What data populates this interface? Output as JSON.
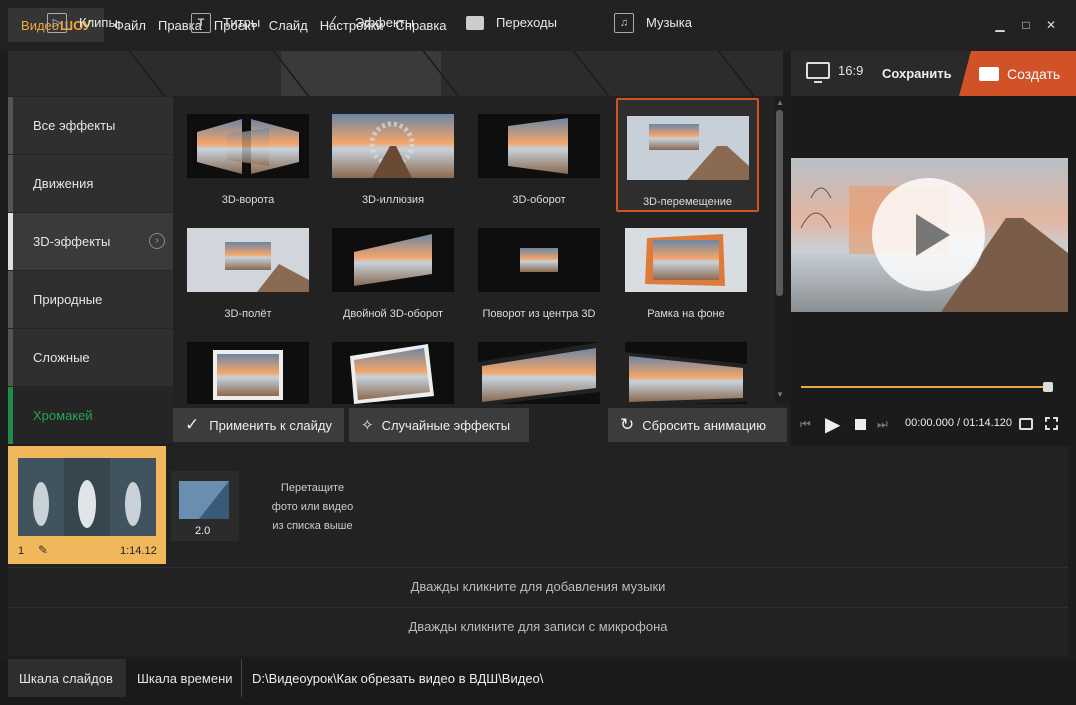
{
  "app": {
    "title_part1": "Видео",
    "title_part2": "ШОУ"
  },
  "menu": [
    "Файл",
    "Правка",
    "Проект",
    "Слайд",
    "Настройки",
    "Справка"
  ],
  "window_controls": {
    "minimize": "▁",
    "maximize": "□",
    "close": "✕"
  },
  "tabs": [
    {
      "label": "Клипы",
      "icon": "play-icon"
    },
    {
      "label": "Титры",
      "icon": "text-icon"
    },
    {
      "label": "Эффекты",
      "icon": "magic-wand-icon"
    },
    {
      "label": "Переходы",
      "icon": "clapper-icon"
    },
    {
      "label": "Музыка",
      "icon": "music-note-icon"
    }
  ],
  "header_right": {
    "ratio": "16:9",
    "save": "Сохранить",
    "create": "Создать"
  },
  "sidebar": [
    {
      "label": "Все эффекты"
    },
    {
      "label": "Движения"
    },
    {
      "label": "3D-эффекты",
      "active": true
    },
    {
      "label": "Природные"
    },
    {
      "label": "Сложные"
    },
    {
      "label": "Хромакей",
      "green": true
    }
  ],
  "effects": [
    {
      "label": "3D-ворота"
    },
    {
      "label": "3D-иллюзия"
    },
    {
      "label": "3D-оборот"
    },
    {
      "label": "3D-перемещение",
      "selected": true
    },
    {
      "label": "3D-полёт"
    },
    {
      "label": "Двойной 3D-оборот"
    },
    {
      "label": "Поворот из центра 3D"
    },
    {
      "label": "Рамка на фоне"
    }
  ],
  "actions": {
    "apply": "Применить к слайду",
    "random": "Случайные эффекты",
    "reset": "Сбросить анимацию"
  },
  "player": {
    "time_current": "00:00.000",
    "time_separator": " / ",
    "time_total": "01:14.120",
    "progress": 0.98
  },
  "timeline": {
    "clip1": {
      "number": "1",
      "duration": "1:14.12"
    },
    "transition": {
      "value": "2.0"
    },
    "drop_hint": [
      "Перетащите",
      "фото или видео",
      "из списка выше"
    ],
    "music_hint": "Дважды кликните для добавления музыки",
    "mic_hint": "Дважды кликните для записи с микрофона"
  },
  "status": {
    "tab1": "Шкала слайдов",
    "tab2": "Шкала времени",
    "path": "D:\\Видеоурок\\Как обрезать видео в ВДШ\\Видео\\"
  },
  "colors": {
    "accent": "#d25228",
    "gold": "#f0a83c",
    "green": "#27a35a"
  }
}
